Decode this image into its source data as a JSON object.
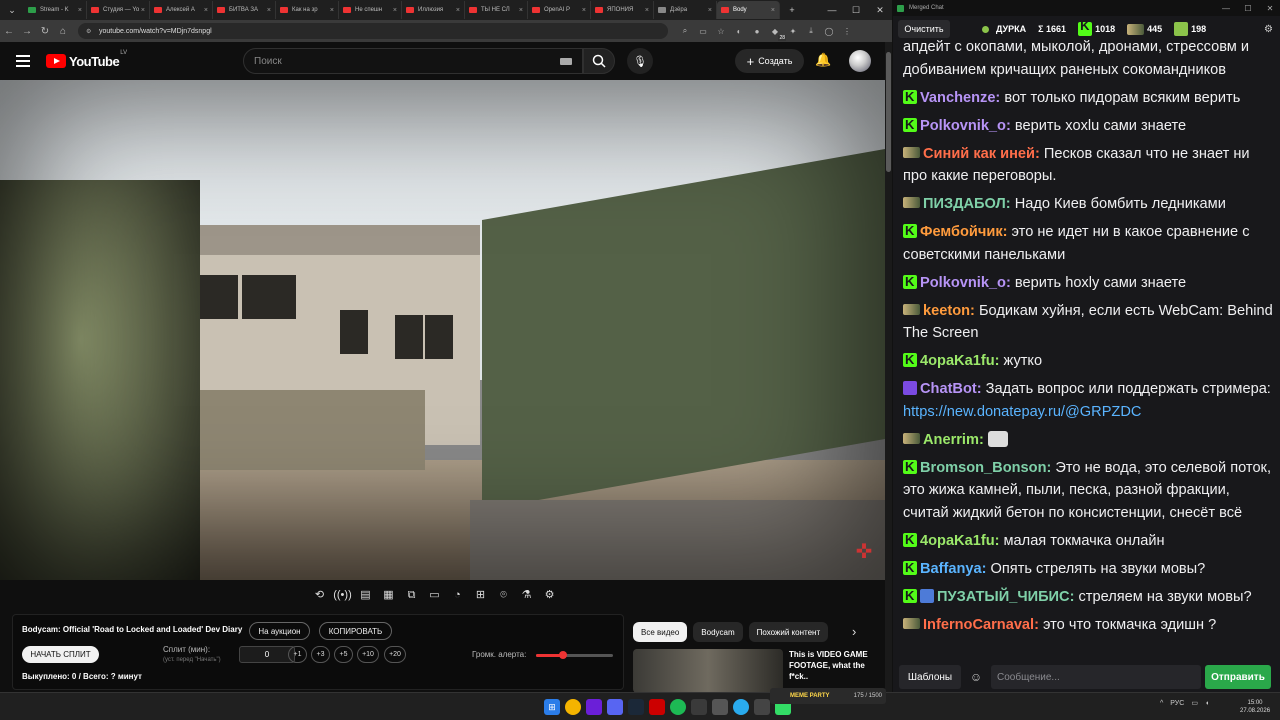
{
  "browser": {
    "tabs": [
      {
        "label": "Stream - K",
        "icon": "kick-icon"
      },
      {
        "label": "Студия — Yo",
        "icon": "youtube-icon"
      },
      {
        "label": "Алексей А",
        "icon": "youtube-icon"
      },
      {
        "label": "БИТВА ЗА",
        "icon": "youtube-icon"
      },
      {
        "label": "Как на зр",
        "icon": "youtube-icon"
      },
      {
        "label": "Не спешн",
        "icon": "youtube-icon"
      },
      {
        "label": "Иллюзия",
        "icon": "youtube-icon"
      },
      {
        "label": "ТЫ НЕ СЛ",
        "icon": "youtube-icon"
      },
      {
        "label": "OpenAI Р",
        "icon": "youtube-icon"
      },
      {
        "label": "ЯПОНИЯ",
        "icon": "youtube-icon"
      },
      {
        "label": "Дзёра",
        "icon": "page-icon"
      },
      {
        "label": "Body",
        "icon": "youtube-icon"
      }
    ],
    "url": "youtube.com/watch?v=MDjn7dsnpgl",
    "ext_badge": "28"
  },
  "yt": {
    "logo_text": "YouTube",
    "region": "LV",
    "search_placeholder": "Поиск",
    "create_label": "Создать"
  },
  "extension": {
    "video_title": "Bodycam: Official 'Road to Locked and Loaded' Dev Diary",
    "auction_label": "На аукцион",
    "copy_label": "КОПИРОВАТЬ",
    "start_split_label": "НАЧАТЬ СПЛИТ",
    "split_label": "Сплит (мин):",
    "split_hint": "(уст. перед \"Начать\")",
    "split_value": "0",
    "increments": [
      "+1",
      "+3",
      "+5",
      "+10",
      "+20"
    ],
    "volume_label": "Громк. алерта:",
    "volume_level": 0.35,
    "stats": "Выкуплено: 0 / Всего: ? минут"
  },
  "chips": [
    "Все видео",
    "Bodycam",
    "Похожий контент"
  ],
  "recommendation": {
    "title": "This is VIDEO GAME FOOTAGE, what the f*ck..",
    "overlay_label": "MEME PARTY",
    "overlay_progress": "175 / 1500"
  },
  "chat": {
    "window_title": "Merged Chat",
    "clear_label": "Очистить",
    "channel_name": "ДУРКА",
    "total": "Σ 1661",
    "kick_count": "1018",
    "twitch_count": "445",
    "other_count": "198",
    "templates_label": "Шаблоны",
    "input_placeholder": "Сообщение...",
    "send_label": "Отправить",
    "messages": [
      {
        "badge": "none",
        "user": "",
        "color": "#efeff1",
        "text": "апдейт с окопами, мыколой, дронами, стрессовм и добиванием кричащих раненых сокомандников"
      },
      {
        "badge": "k",
        "user": "Vanchenze:",
        "color": "#b794f6",
        "text": " вот только пидорам всяким верить"
      },
      {
        "badge": "k",
        "user": "Polkovnik_o:",
        "color": "#b794f6",
        "text": " верить xoxlu сами знаете"
      },
      {
        "badge": "t",
        "user": "Синий как иней:",
        "color": "#ff6e4a",
        "text": " Песков сказал что не знает ни про какие переговоры."
      },
      {
        "badge": "t",
        "user": "ПИЗДАБОЛ:",
        "color": "#7fd0a8",
        "text": " Надо Киев бомбить ледниками"
      },
      {
        "badge": "k",
        "user": "Фембойчик:",
        "color": "#ff9b3d",
        "text": " это не идет ни в какое сравнение с советскими панельками"
      },
      {
        "badge": "k",
        "user": "Polkovnik_o:",
        "color": "#b794f6",
        "text": " верить hoxly сами знаете"
      },
      {
        "badge": "t",
        "user": "keeton:",
        "color": "#ff9b3d",
        "text": " Бодикам хуйня, если есть WebCam: Behind The Screen"
      },
      {
        "badge": "k",
        "user": "4opaKa1fu:",
        "color": "#9be86a",
        "text": " жутко"
      },
      {
        "badge": "bot",
        "user": "ChatBot:",
        "color": "#b794f6",
        "text": " Задать вопрос или поддержать стримера: ",
        "link": "https://new.donatepay.ru/@GRPZDC"
      },
      {
        "badge": "t",
        "user": "Anerrim:",
        "color": "#9be86a",
        "text": " ",
        "emote": true
      },
      {
        "badge": "k",
        "user": "Bromson_Bonson:",
        "color": "#7fd0a8",
        "text": " Это не вода, это селевой поток, это жижа камней, пыли, песка, разной фракции, считай жидкий бетон по консистенции, снесёт всё"
      },
      {
        "badge": "k",
        "user": "4opaKa1fu:",
        "color": "#9be86a",
        "text": " малая токмачка онлайн"
      },
      {
        "badge": "k",
        "user": "Baffanya:",
        "color": "#5ab4ff",
        "text": " Опять стрелять на звуки мовы?"
      },
      {
        "badge": "k2",
        "user": "ПУЗАТЫЙ_ЧИБИС:",
        "color": "#7fd0a8",
        "text": " стреляем на звуки мовы?"
      },
      {
        "badge": "t",
        "user": "InfernoCarnaval:",
        "color": "#ff6e4a",
        "text": " это что токмачка эдишн ?"
      }
    ]
  },
  "taskbar": {
    "lang": "РУС",
    "time": "15:00",
    "date": "27.08.2026"
  }
}
